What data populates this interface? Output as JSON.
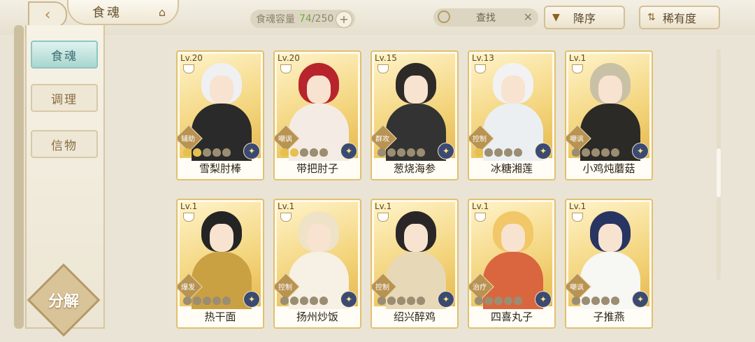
{
  "header": {
    "title": "食魂",
    "back_icon": "back-arrow-icon",
    "hat_icon": "hat-icon",
    "capacity_label": "食魂容量",
    "capacity_current": "74",
    "capacity_total": "/250",
    "plus": "+",
    "search_placeholder": "查找",
    "clear_icon": "✕",
    "sort_label": "降序",
    "rarity_label": "稀有度"
  },
  "sidebar": {
    "items": [
      {
        "label": "食魂",
        "active": true
      },
      {
        "label": "调理",
        "active": false
      },
      {
        "label": "信物",
        "active": false
      }
    ],
    "decompose_label": "分解"
  },
  "colors": {
    "card_border": "#e3bf6c",
    "active_tab": "#a9d6cf",
    "star_on": "#e6c04e"
  },
  "cards": [
    {
      "level": "Lv.20",
      "name": "雪梨肘棒",
      "role": "辅助",
      "stars": 2,
      "hair": "#eef0f2",
      "outfit": "#2a2a2a"
    },
    {
      "level": "Lv.20",
      "name": "带把肘子",
      "role": "嘲讽",
      "stars": 2,
      "hair": "#b8242c",
      "outfit": "#f4ece4"
    },
    {
      "level": "Lv.15",
      "name": "葱烧海参",
      "role": "群攻",
      "stars": 0,
      "hair": "#2e2a28",
      "outfit": "#333333"
    },
    {
      "level": "Lv.13",
      "name": "冰糖湘莲",
      "role": "控制",
      "stars": 1,
      "hair": "#f2f2f4",
      "outfit": "#eceff2"
    },
    {
      "level": "Lv.1",
      "name": "小鸡炖蘑菇",
      "role": "嘲讽",
      "stars": 0,
      "hair": "#c9c1a6",
      "outfit": "#2c2a26"
    },
    {
      "level": "Lv.1",
      "name": "热干面",
      "role": "爆发",
      "stars": 0,
      "hair": "#242424",
      "outfit": "#caa142"
    },
    {
      "level": "Lv.1",
      "name": "扬州炒饭",
      "role": "控制",
      "stars": 0,
      "hair": "#eee3c6",
      "outfit": "#f6f1e4"
    },
    {
      "level": "Lv.1",
      "name": "绍兴醉鸡",
      "role": "控制",
      "stars": 0,
      "hair": "#2a2628",
      "outfit": "#e7d8b8"
    },
    {
      "level": "Lv.1",
      "name": "四喜丸子",
      "role": "治疗",
      "stars": 0,
      "hair": "#f1c767",
      "outfit": "#d9663e"
    },
    {
      "level": "Lv.1",
      "name": "子推燕",
      "role": "嘲讽",
      "stars": 0,
      "hair": "#283563",
      "outfit": "#f7f7f4"
    }
  ]
}
